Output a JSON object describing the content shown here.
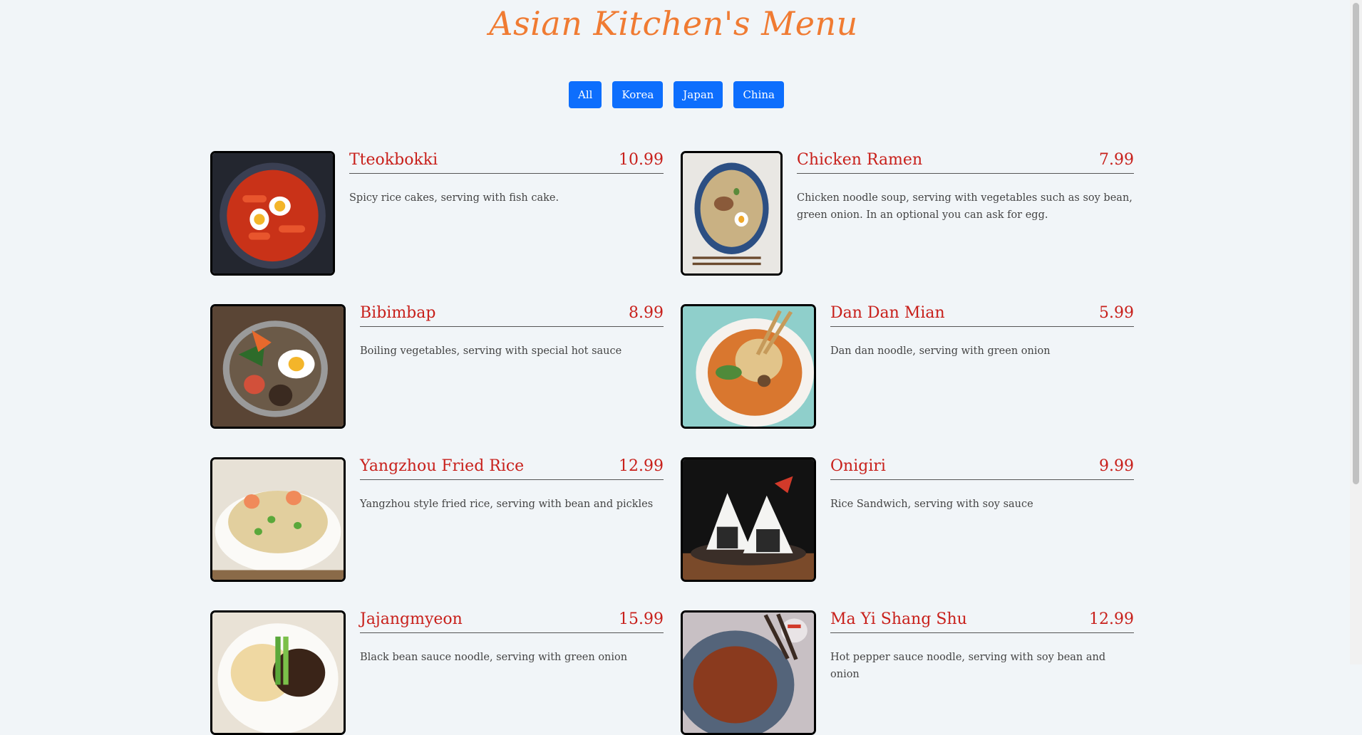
{
  "title": "Asian Kitchen's Menu",
  "filters": [
    "All",
    "Korea",
    "Japan",
    "China"
  ],
  "items": [
    {
      "name": "Tteokbokki",
      "price": "10.99",
      "desc": "Spicy rice cakes, serving with fish cake."
    },
    {
      "name": "Chicken Ramen",
      "price": "7.99",
      "desc": "Chicken noodle soup, serving with vegetables such as soy bean, green onion. In an optional you can ask for egg."
    },
    {
      "name": "Bibimbap",
      "price": "8.99",
      "desc": "Boiling vegetables, serving with special hot sauce"
    },
    {
      "name": "Dan Dan Mian",
      "price": "5.99",
      "desc": "Dan dan noodle, serving with green onion"
    },
    {
      "name": "Yangzhou Fried Rice",
      "price": "12.99",
      "desc": "Yangzhou style fried rice, serving with bean and pickles"
    },
    {
      "name": "Onigiri",
      "price": "9.99",
      "desc": "Rice Sandwich, serving with soy sauce"
    },
    {
      "name": "Jajangmyeon",
      "price": "15.99",
      "desc": "Black bean sauce noodle, serving with green onion"
    },
    {
      "name": "Ma Yi Shang Shu",
      "price": "12.99",
      "desc": "Hot pepper sauce noodle, serving with soy bean and onion"
    }
  ],
  "colors": {
    "accent": "#0d6efd",
    "title": "#f07b32",
    "item": "#c8201b",
    "background": "#f1f5f8"
  }
}
